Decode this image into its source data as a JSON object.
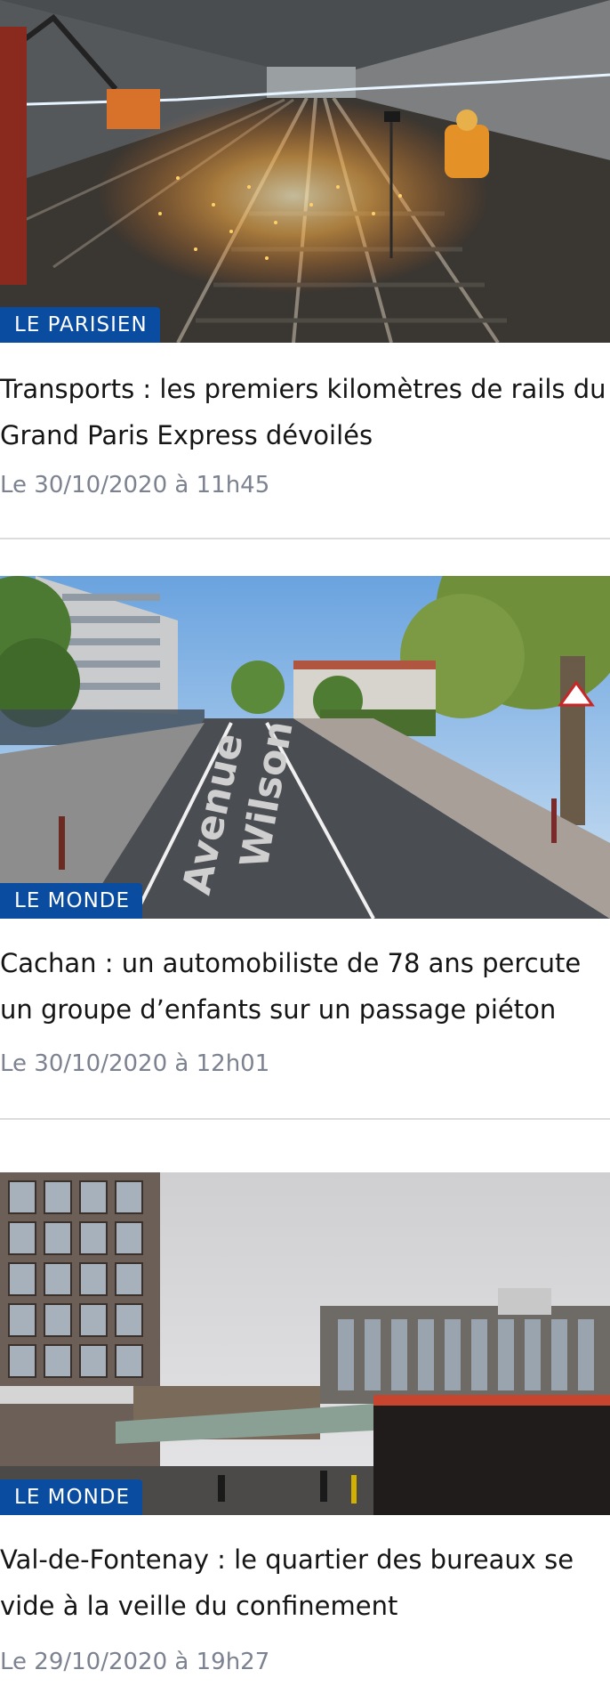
{
  "articles": [
    {
      "source": "LE PARISIEN",
      "title": "Transports : les premiers kilomètres de rails du Grand Paris Express dévoilés",
      "date": "Le 30/10/2020 à 11h45",
      "image_icon": "tunnel-construction-photo"
    },
    {
      "source": "LE MONDE",
      "title": "Cachan : un automobiliste de 78 ans percute un groupe d’enfants sur un passage piéton",
      "date": "Le 30/10/2020 à 12h01",
      "image_icon": "street-avenue-photo",
      "road_text_1": "Avenue",
      "road_text_2": "Wilson"
    },
    {
      "source": "LE MONDE",
      "title": "Val-de-Fontenay : le quartier des bureaux se vide à la veille du confinement",
      "date": "Le 29/10/2020 à 19h27",
      "image_icon": "office-district-photo"
    }
  ],
  "colors": {
    "badge_background": "#0a4da0",
    "date_text": "#7c8290",
    "divider": "#dcdcdc"
  }
}
